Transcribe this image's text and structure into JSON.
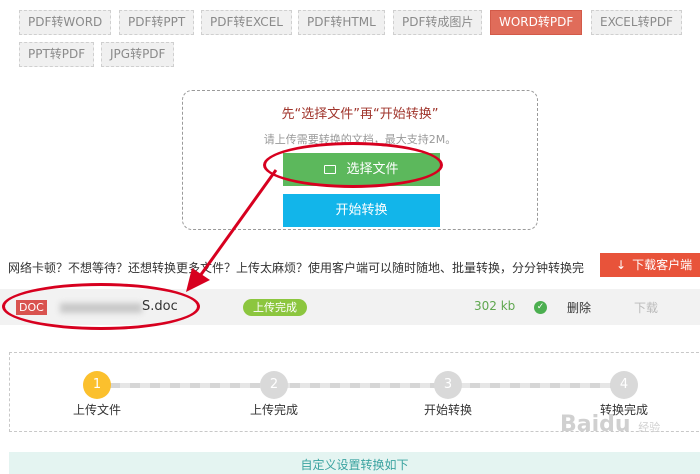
{
  "tabs": [
    {
      "label": "PDF转WORD",
      "active": false
    },
    {
      "label": "PDF转PPT",
      "active": false
    },
    {
      "label": "PDF转EXCEL",
      "active": false
    },
    {
      "label": "PDF转HTML",
      "active": false
    },
    {
      "label": "PDF转成图片",
      "active": false
    },
    {
      "label": "WORD转PDF",
      "active": true
    },
    {
      "label": "EXCEL转PDF",
      "active": false
    },
    {
      "label": "PPT转PDF",
      "active": false
    },
    {
      "label": "JPG转PDF",
      "active": false
    }
  ],
  "upload": {
    "headline": "先“选择文件”再“开始转换”",
    "subline": "请上传需要转换的文档，最大支持2M。",
    "choose_label": "选择文件",
    "start_label": "开始转换"
  },
  "notice": {
    "text": "网络卡顿？不想等待？还想转换更多文件？上传太麻烦？使用客户端可以随时随地、批量转换，分分钟转换完",
    "download_client_label": "下载客户端"
  },
  "file": {
    "type_badge": "DOC",
    "name_suffix": "S.doc",
    "status": "上传完成",
    "size": "302 kb",
    "delete_label": "删除",
    "download_label": "下载"
  },
  "steps": [
    {
      "number": "1",
      "label": "上传文件",
      "active": true
    },
    {
      "number": "2",
      "label": "上传完成",
      "active": false
    },
    {
      "number": "3",
      "label": "开始转换",
      "active": false
    },
    {
      "number": "4",
      "label": "转换完成",
      "active": false
    }
  ],
  "settings_bar": "自定义设置转换如下",
  "watermark": {
    "brand": "Baidu",
    "sub": "经验"
  },
  "colors": {
    "active_tab": "#e06c5a",
    "choose_button": "#5cb85c",
    "start_button": "#12b5ea",
    "annotation": "#d7001f",
    "step_active": "#fbc02d",
    "download_client": "#e8533a"
  }
}
